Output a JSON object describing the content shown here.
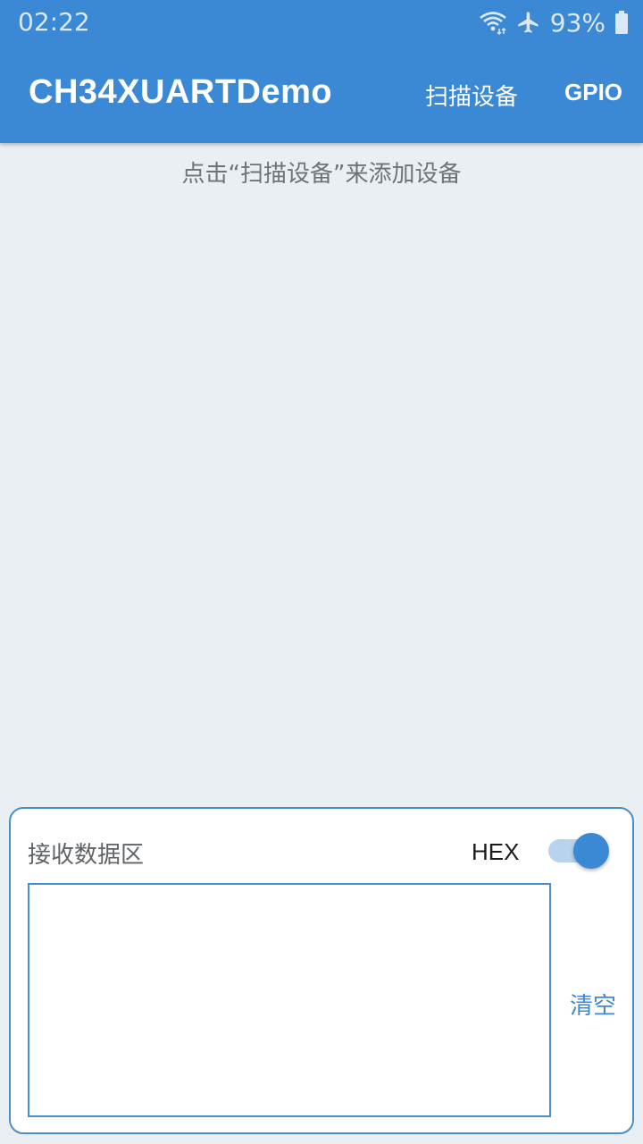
{
  "status_bar": {
    "time": "02:22",
    "battery_percent": "93%",
    "icons": [
      "wifi-icon",
      "airplane-icon",
      "battery-icon"
    ]
  },
  "toolbar": {
    "title": "CH34XUARTDemo",
    "scan_label": "扫描设备",
    "gpio_label": "GPIO"
  },
  "main": {
    "hint": "点击“扫描设备”来添加设备"
  },
  "receive": {
    "title": "接收数据区",
    "hex_label": "HEX",
    "hex_enabled": true,
    "data": "",
    "clear_label": "清空"
  },
  "colors": {
    "primary": "#3b89d4",
    "background": "#e9eff2",
    "border": "#4a8fc9"
  }
}
